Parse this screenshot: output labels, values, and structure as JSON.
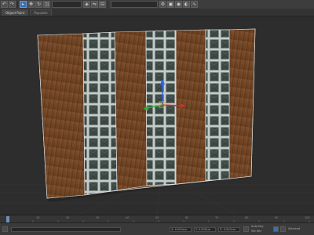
{
  "app": {
    "name": "3ds Max"
  },
  "toolbar": {
    "buttons": [
      "undo-icon",
      "redo-icon",
      "select-icon",
      "move-icon",
      "rotate-icon",
      "scale-icon",
      "snap-icon",
      "mirror-icon",
      "align-icon",
      "render-setup-icon",
      "render-frame-icon",
      "render-icon"
    ]
  },
  "tabs": [
    {
      "label": "Object Paint"
    },
    {
      "label": "Populate"
    }
  ],
  "viewport": {
    "label": "",
    "wall_color": "#7a4a2a",
    "tile_color": "#3f4b47",
    "grout_color": "#c9d1cf"
  },
  "timeline": {
    "labels": [
      "0",
      "10",
      "20",
      "30",
      "40",
      "50",
      "60",
      "70",
      "80",
      "90",
      "100"
    ]
  },
  "statusbar": {
    "x_field": "X: 0.000cm",
    "y_field": "Y: 0.000cm",
    "z_field": "Z: 0.000cm",
    "selected_label": "Selected",
    "auto_key_label": "Auto Key",
    "set_key_label": "Set Key"
  }
}
